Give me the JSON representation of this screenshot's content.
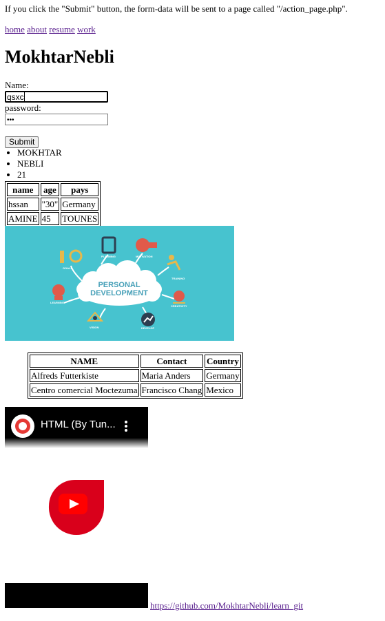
{
  "intro_text": "If you click the \"Submit\" button, the form-data will be sent to a page called \"/action_page.php\".",
  "nav": [
    "home",
    "about",
    "resume",
    "work"
  ],
  "heading": "MokhtarNebli",
  "form": {
    "name_label": "Name:",
    "name_value": "qsxc",
    "password_label": "password:",
    "password_value": "•••",
    "submit_label": "Submit"
  },
  "list_items": [
    "MOKHTAR",
    "NEBLI",
    "21"
  ],
  "table1": {
    "headers": [
      "name",
      "age",
      "pays"
    ],
    "rows": [
      [
        "hssan",
        "\"30\"",
        "Germany"
      ],
      [
        "AMINE",
        "45",
        "TOUNES"
      ]
    ]
  },
  "image": {
    "center_text_1": "PERSONAL",
    "center_text_2": "DEVELOPMENT",
    "labels": [
      "PLANNING",
      "MOTIVATION",
      "GOALS",
      "TRAINING",
      "LEARNING",
      "CREATIVITY",
      "VISION",
      "DEVELOP"
    ]
  },
  "table2": {
    "headers": [
      "NAME",
      "Contact",
      "Country"
    ],
    "rows": [
      [
        "Alfreds Futterkiste",
        "Maria Anders",
        "Germany"
      ],
      [
        "Centro comercial Moctezuma",
        "Francisco Chang",
        "Mexico"
      ]
    ]
  },
  "video": {
    "title": "HTML (By Tun..."
  },
  "github_link": "https://github.com/MokhtarNebli/learn_git",
  "colors": {
    "link": "#551a8b",
    "image_bg": "#47c3cf",
    "youtube_red": "#ff0000"
  }
}
